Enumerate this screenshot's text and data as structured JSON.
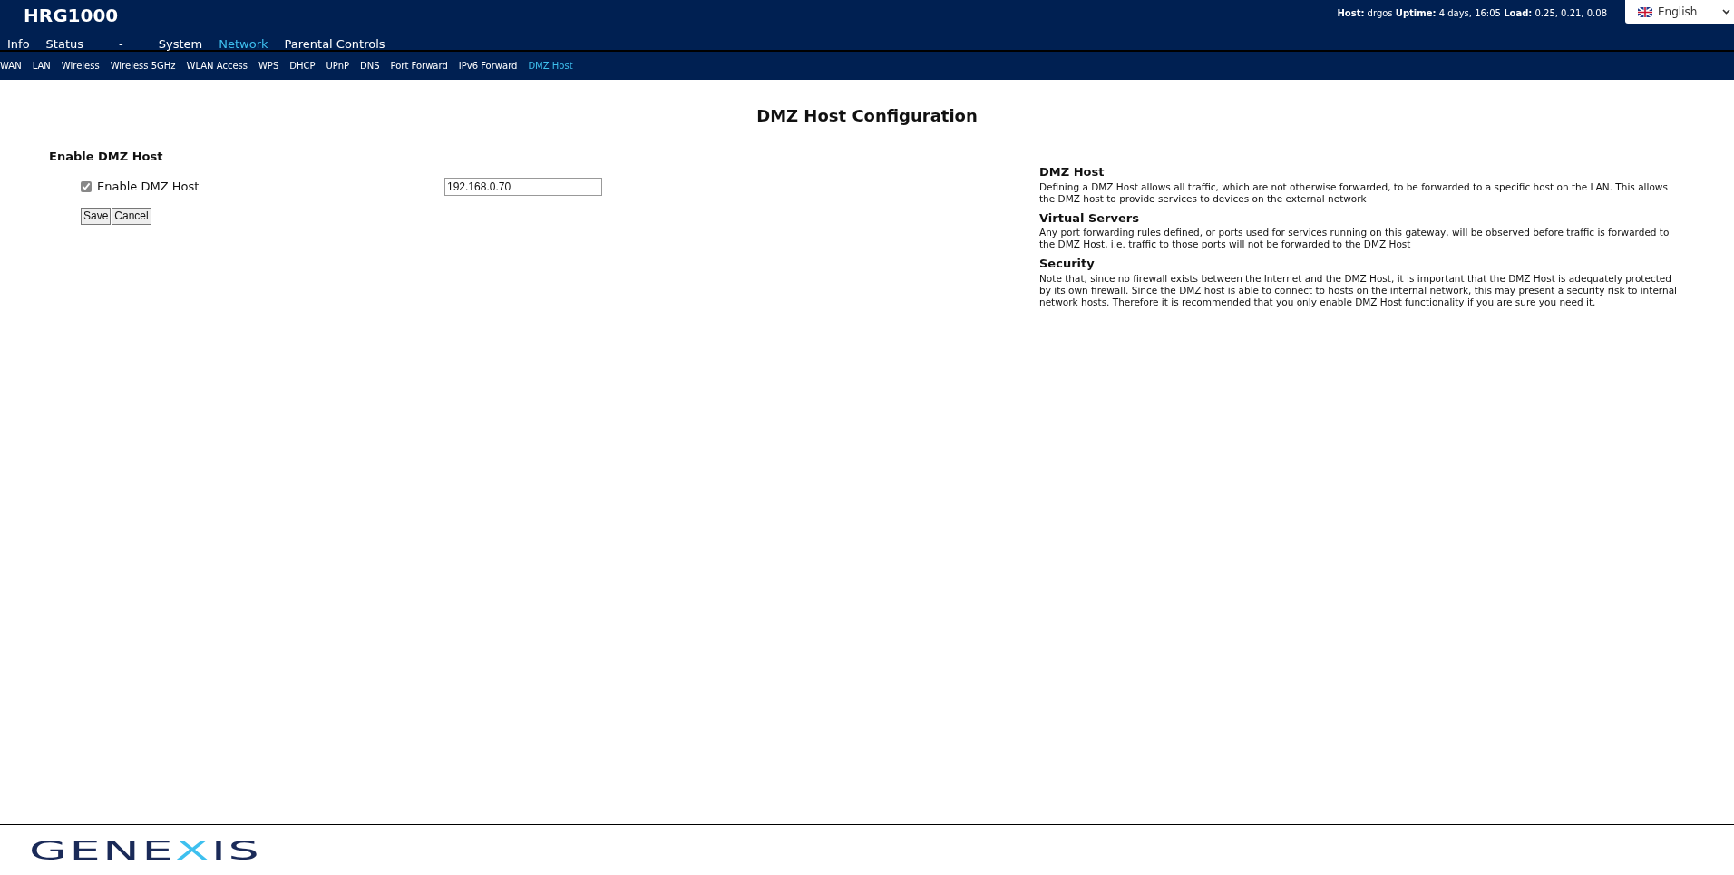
{
  "header": {
    "title": "HRG1000",
    "status": "**Host:** drgos **Uptime:** 4 days, 16:05 **Load:** 0.25, 0.21, 0.08",
    "language": "English"
  },
  "menu": [
    {
      "label": "Info",
      "selected": false
    },
    {
      "label": "Status",
      "selected": false
    },
    {
      "label": "-",
      "selected": false
    },
    {
      "label": "System",
      "selected": false
    },
    {
      "label": "Network",
      "selected": true
    },
    {
      "label": "Parental Controls",
      "selected": false
    }
  ],
  "submenu": [
    {
      "label": "WAN",
      "selected": false
    },
    {
      "label": "LAN",
      "selected": false
    },
    {
      "label": "Wireless",
      "selected": false
    },
    {
      "label": "Wireless 5GHz",
      "selected": false
    },
    {
      "label": "WLAN Access",
      "selected": false
    },
    {
      "label": "WPS",
      "selected": false
    },
    {
      "label": "DHCP",
      "selected": false
    },
    {
      "label": "UPnP",
      "selected": false
    },
    {
      "label": "DNS",
      "selected": false
    },
    {
      "label": "Port Forward",
      "selected": false
    },
    {
      "label": "IPv6 Forward",
      "selected": false
    },
    {
      "label": "DMZ Host",
      "selected": true
    }
  ],
  "page_title": "DMZ Host Configuration",
  "form": {
    "section": "Enable DMZ Host",
    "checkbox": {
      "label": "Enable DMZ Host",
      "checked": true
    },
    "ip_field": {
      "value": "192.168.0.70"
    },
    "buttons": [
      "Save",
      "Cancel"
    ]
  },
  "help": [
    {
      "title": "DMZ Host",
      "text": "Defining a DMZ Host allows all traffic, which are not otherwise forwarded, to be forwarded to a specific host on the LAN. This allows the DMZ host to provide services to devices on the external network"
    },
    {
      "title": "Virtual Servers",
      "text": "Any port forwarding rules defined, or ports used for services running on this gateway, will be observed before traffic is forwarded to the DMZ Host, i.e. traffic to those ports will not be forwarded to the DMZ Host"
    },
    {
      "title": "Security",
      "text": "Note that, since no firewall exists between the Internet and the DMZ Host, it is important that the DMZ Host is adequately protected by its own firewall. Since the DMZ host is able to connect to hosts on the internal network, this may present a security risk to internal network hosts. Therefore it is recommended that you only enable DMZ Host functionality if you are sure you need it."
    }
  ],
  "footer": {
    "logo": [
      {
        "text": "GENE",
        "accent": false
      },
      {
        "text": "X",
        "accent": true
      },
      {
        "text": "IS",
        "accent": false
      }
    ]
  }
}
